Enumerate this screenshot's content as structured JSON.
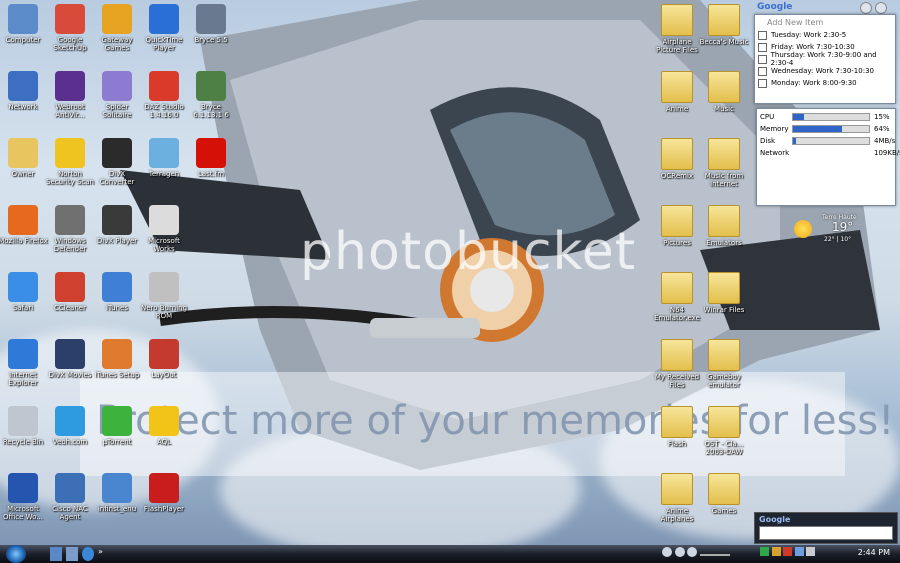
{
  "desktop": {
    "left_icons": [
      {
        "label": "Computer",
        "color": "#5b8cc9",
        "col": 0,
        "row": 0
      },
      {
        "label": "Google SketchUp",
        "color": "#d84b3a",
        "col": 1,
        "row": 0
      },
      {
        "label": "Gateway Games",
        "color": "#e6a221",
        "col": 2,
        "row": 0
      },
      {
        "label": "QuickTime Player",
        "color": "#2a6fd6",
        "col": 3,
        "row": 0
      },
      {
        "label": "Bryce 5.5",
        "color": "#6a7a8e",
        "col": 4,
        "row": 0
      },
      {
        "label": "Network",
        "color": "#3c6fc1",
        "col": 0,
        "row": 1
      },
      {
        "label": "Webroot AntiVir...",
        "color": "#5a2f8e",
        "col": 1,
        "row": 1
      },
      {
        "label": "Spider Solitaire",
        "color": "#8d7ad1",
        "col": 2,
        "row": 1
      },
      {
        "label": "DAZ Studio 1.4.16.0",
        "color": "#d93a2a",
        "col": 3,
        "row": 1
      },
      {
        "label": "Bryce 6.1.13.1 6",
        "color": "#4e7f45",
        "col": 4,
        "row": 1
      },
      {
        "label": "Owner",
        "color": "#e8c55e",
        "col": 0,
        "row": 2
      },
      {
        "label": "Norton Security Scan",
        "color": "#f0c420",
        "col": 1,
        "row": 2
      },
      {
        "label": "DivX Converter",
        "color": "#2b2b2b",
        "col": 2,
        "row": 2
      },
      {
        "label": "Terragen",
        "color": "#6cb0e0",
        "col": 3,
        "row": 2
      },
      {
        "label": "Last.fm",
        "color": "#d51007",
        "col": 4,
        "row": 2
      },
      {
        "label": "Mozilla Firefox",
        "color": "#e56a1e",
        "col": 0,
        "row": 3
      },
      {
        "label": "Windows Defender",
        "color": "#707070",
        "col": 1,
        "row": 3
      },
      {
        "label": "DivX Player",
        "color": "#3a3a3a",
        "col": 2,
        "row": 3
      },
      {
        "label": "Microsoft Works",
        "color": "#dcdcdc",
        "col": 3,
        "row": 3
      },
      {
        "label": "Safari",
        "color": "#3a8ee6",
        "col": 0,
        "row": 4
      },
      {
        "label": "CCleaner",
        "color": "#d0402e",
        "col": 1,
        "row": 4
      },
      {
        "label": "iTunes",
        "color": "#3f7fd6",
        "col": 2,
        "row": 4
      },
      {
        "label": "Nero Burning ROM",
        "color": "#c0c0c0",
        "col": 3,
        "row": 4
      },
      {
        "label": "Internet Explorer",
        "color": "#2f79d9",
        "col": 0,
        "row": 5
      },
      {
        "label": "DivX Movies",
        "color": "#2c3e6a",
        "col": 1,
        "row": 5
      },
      {
        "label": "iTunes Setup",
        "color": "#e07a2f",
        "col": 2,
        "row": 5
      },
      {
        "label": "LayOut",
        "color": "#c43a2e",
        "col": 3,
        "row": 5
      },
      {
        "label": "Recycle Bin",
        "color": "#bfc6cf",
        "col": 0,
        "row": 6
      },
      {
        "label": "Veoh.com",
        "color": "#2e9be0",
        "col": 1,
        "row": 6
      },
      {
        "label": "µTorrent",
        "color": "#3db33d",
        "col": 2,
        "row": 6
      },
      {
        "label": "AQL",
        "color": "#f2c418",
        "col": 3,
        "row": 6
      },
      {
        "label": "Microsoft Office Wo...",
        "color": "#2456b0",
        "col": 0,
        "row": 7
      },
      {
        "label": "Cisco NAC Agent",
        "color": "#3d6fb6",
        "col": 1,
        "row": 7
      },
      {
        "label": "infinst_enu",
        "color": "#4a86d0",
        "col": 2,
        "row": 7
      },
      {
        "label": "FlashPlayer",
        "color": "#c81d1d",
        "col": 3,
        "row": 7
      }
    ],
    "right_icons": [
      {
        "label": "Airplane Picture Files",
        "col": 0,
        "row": 0
      },
      {
        "label": "Becca's Music",
        "col": 1,
        "row": 0
      },
      {
        "label": "Anime",
        "col": 0,
        "row": 1
      },
      {
        "label": "Music",
        "col": 1,
        "row": 1
      },
      {
        "label": "OCRemix",
        "col": 0,
        "row": 2
      },
      {
        "label": "Music from Internet",
        "col": 1,
        "row": 2
      },
      {
        "label": "Pictures",
        "col": 0,
        "row": 3
      },
      {
        "label": "Emulators",
        "col": 0,
        "row": 3.2
      },
      {
        "label": "N64 Emulator.exe",
        "col": 0,
        "row": 4
      },
      {
        "label": "Winrar Files",
        "col": 1,
        "row": 4
      },
      {
        "label": "My Received Files",
        "col": 0,
        "row": 5
      },
      {
        "label": "Gameboy emulator",
        "col": 1,
        "row": 5
      },
      {
        "label": "Flash",
        "col": 0,
        "row": 6
      },
      {
        "label": "OST - Cla... 2003-DAW",
        "col": 1,
        "row": 6
      },
      {
        "label": "Anime Airplanes",
        "col": 0,
        "row": 7
      },
      {
        "label": "Games",
        "col": 1,
        "row": 7
      }
    ]
  },
  "watermark": {
    "brand": "photobucket",
    "banner": "Protect more of your memories for less!"
  },
  "todo_gadget": {
    "logo": "Google",
    "add_label": "Add New Item",
    "items": [
      "Tuesday: Work 2:30-5",
      "Friday: Work 7:30-10:30",
      "Thursday: Work 7:30-9:00 and 2:30-4",
      "Wednesday: Work 7:30-10:30",
      "Monday: Work 8:00-9:30"
    ]
  },
  "sysmon_gadget": {
    "rows": [
      {
        "label": "CPU",
        "value": "15%",
        "fill": 0.15
      },
      {
        "label": "Memory",
        "value": "64%",
        "fill": 0.64
      },
      {
        "label": "Disk",
        "value": "4MB/s",
        "fill": 0.04
      },
      {
        "label": "Network",
        "value": "109KB/s",
        "fill": 0.0
      }
    ]
  },
  "weather": {
    "city": "Terre Haute",
    "temp": "19°",
    "range": "22° | 10°"
  },
  "search_gadget": {
    "logo": "Google"
  },
  "taskbar": {
    "clock": "2:44 PM"
  },
  "colors": {
    "taskbar": "#1b1f28",
    "accent": "#2f64c8",
    "folder": "#e3bf4c"
  }
}
